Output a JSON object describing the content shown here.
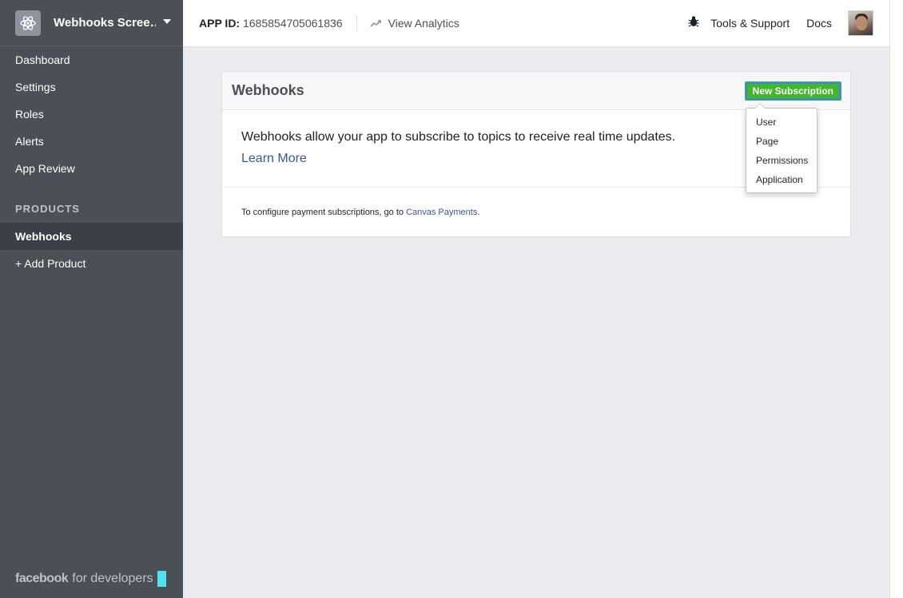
{
  "sidebar": {
    "app_name": "Webhooks Scree…",
    "items": [
      {
        "label": "Dashboard"
      },
      {
        "label": "Settings"
      },
      {
        "label": "Roles"
      },
      {
        "label": "Alerts"
      },
      {
        "label": "App Review"
      }
    ],
    "products_heading": "PRODUCTS",
    "products": [
      {
        "label": "Webhooks",
        "active": true
      },
      {
        "label": "+ Add Product"
      }
    ],
    "brand": {
      "facebook": "facebook",
      "for_developers": "for developers"
    }
  },
  "topbar": {
    "app_id_label": "APP ID:",
    "app_id_value": "1685854705061836",
    "analytics_label": "View Analytics",
    "tools_label": "Tools & Support",
    "docs_label": "Docs"
  },
  "card": {
    "title": "Webhooks",
    "new_subscription_label": "New Subscription",
    "description": "Webhooks allow your app to subscribe to topics to receive real time updates.",
    "learn_more": "Learn More",
    "footer_prefix": "To configure payment subscriptions, go to ",
    "footer_link": "Canvas Payments",
    "footer_suffix": "."
  },
  "dropdown": {
    "items": [
      "User",
      "Page",
      "Permissions",
      "Application"
    ]
  },
  "colors": {
    "sidebar_bg": "#4b4f56",
    "accent_green": "#42b72a",
    "link_blue": "#365899"
  }
}
